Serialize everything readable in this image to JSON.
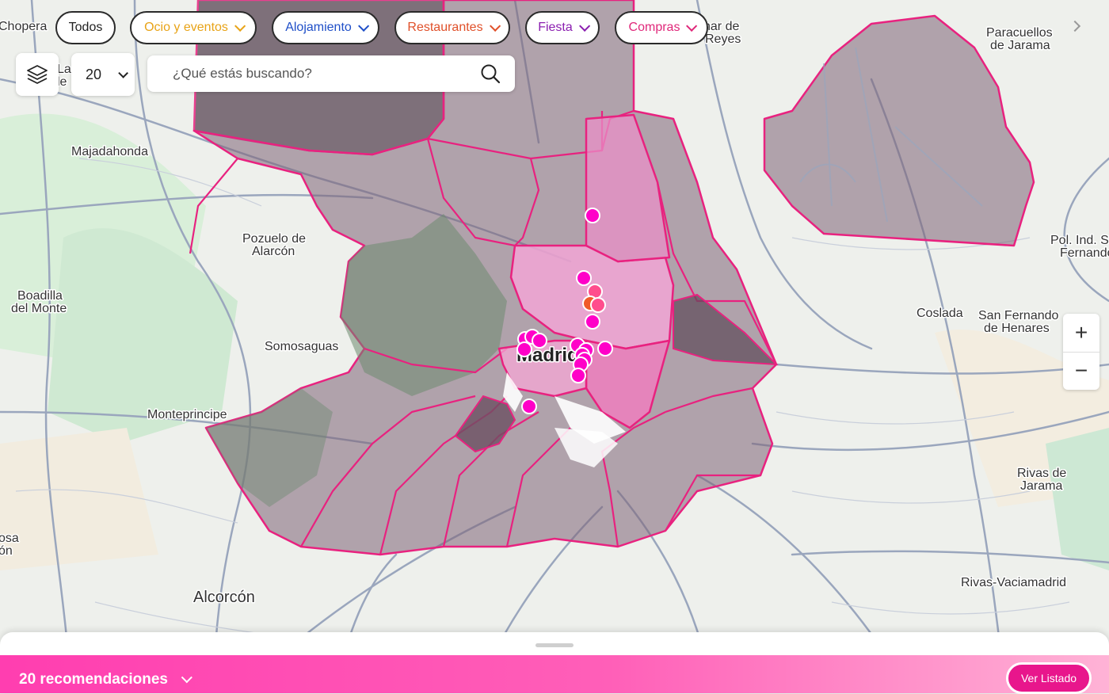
{
  "filters": {
    "todos": {
      "label": "Todos",
      "color": "#222222"
    },
    "ocio": {
      "label": "Ocio y eventos",
      "color": "#e8a317"
    },
    "alojamiento": {
      "label": "Alojamiento",
      "color": "#1f4fc8"
    },
    "restaurantes": {
      "label": "Restaurantes",
      "color": "#e0502a"
    },
    "fiesta": {
      "label": "Fiesta",
      "color": "#8b1fb0"
    },
    "compras": {
      "label": "Compras",
      "color": "#e0287a"
    }
  },
  "controls": {
    "layers_icon": "layers-icon",
    "results_count_value": "20",
    "search_placeholder": "¿Qué estás buscando?",
    "search_icon": "search-icon",
    "zoom_in_label": "+",
    "zoom_out_label": "−"
  },
  "map": {
    "labels": {
      "chopera": "Chopera",
      "majadahonda": "Majadahonda",
      "pozuelo_1": "Pozuelo de",
      "pozuelo_2": "Alarcón",
      "boadilla_1": "Boadilla",
      "boadilla_2": "del Monte",
      "somosaguas": "Somosaguas",
      "monteprincipe": "Monteprincipe",
      "alcorcon": "Alcorcón",
      "madrid": "Madrid",
      "paracuellos_1": "Paracuellos",
      "paracuellos_2": "de Jarama",
      "reyes_1": "nar de",
      "reyes_2": "Reyes",
      "polind_1": "Pol. Ind. S",
      "polind_2": "Fernando",
      "coslada": "Coslada",
      "sanfernando_1": "San Fernando",
      "sanfernando_2": "de Henares",
      "rivas_1": "Rivas de",
      "rivas_2": "Jarama",
      "rivasvacia": "Rivas-Vaciamadrid",
      "rosa_1": "osa",
      "rosa_2": "ón",
      "las_1": "Las",
      "las_2": "le"
    },
    "colors": {
      "district_dark": "#7d6377",
      "district_pink": "#f6a6d8",
      "border": "#e8227f",
      "marker": "#ff00c8",
      "marker_alt": "#ff4d6d"
    }
  },
  "bottom_bar": {
    "count_label": "20 recomendaciones",
    "list_button_label": "Ver Listado"
  }
}
